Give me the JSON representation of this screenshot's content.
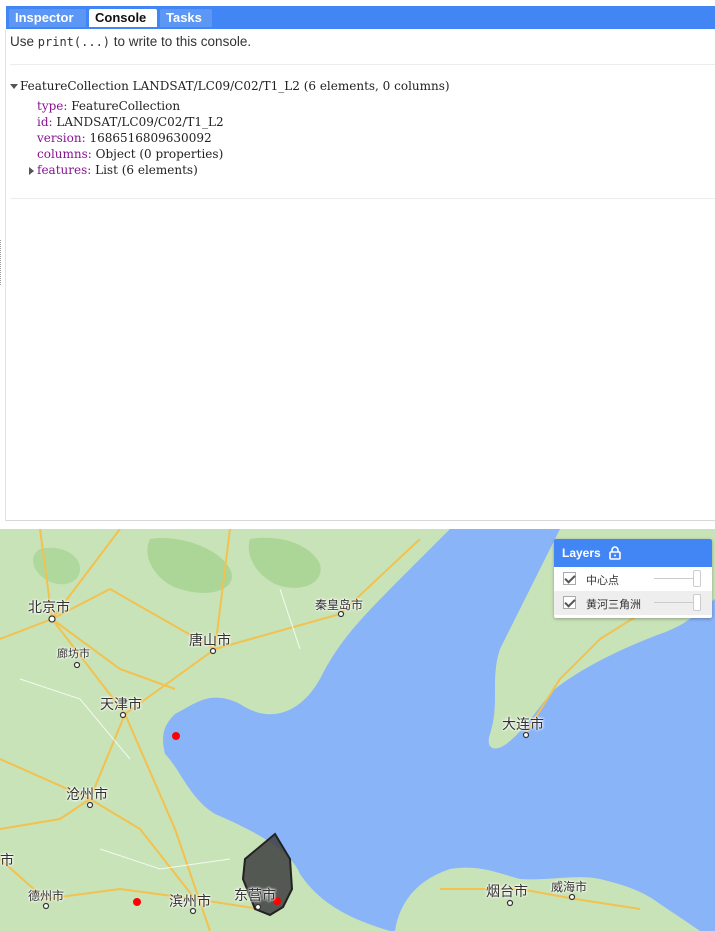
{
  "tabs": [
    {
      "label": "Inspector",
      "active": false
    },
    {
      "label": "Console",
      "active": true
    },
    {
      "label": "Tasks",
      "active": false
    }
  ],
  "console": {
    "hint_prefix": "Use ",
    "hint_code": "print(...)",
    "hint_suffix": " to write to this console.",
    "object": {
      "header": "FeatureCollection LANDSAT/LC09/C02/T1_L2 (6 elements, 0 columns)",
      "props": [
        {
          "key": "type:",
          "value": "FeatureCollection"
        },
        {
          "key": "id:",
          "value": "LANDSAT/LC09/C02/T1_L2"
        },
        {
          "key": "version:",
          "value": "1686516809630092"
        },
        {
          "key": "columns:",
          "value": "Object (0 properties)"
        },
        {
          "key": "features:",
          "value": "List (6 elements)"
        }
      ]
    }
  },
  "layers_panel": {
    "title": "Layers",
    "items": [
      {
        "name": "中心点",
        "checked": true
      },
      {
        "name": "黄河三角洲",
        "checked": true
      }
    ]
  },
  "map": {
    "cities": {
      "beijing": "北京市",
      "langfang": "廊坊市",
      "tangshan": "唐山市",
      "qinhuangdao": "秦皇岛市",
      "tianjin": "天津市",
      "dalian": "大连市",
      "cangzhou": "沧州市",
      "dezhou": "德州市",
      "binzhou": "滨州市",
      "dongying": "东营市",
      "yantai": "烟台市",
      "weihai": "威海市",
      "edge": "市"
    },
    "colors": {
      "sea": "#8ab4f8",
      "land": "#c9e3b8",
      "point": "#ff0000",
      "polygon": "#404040",
      "highway": "#f2c14e"
    }
  }
}
